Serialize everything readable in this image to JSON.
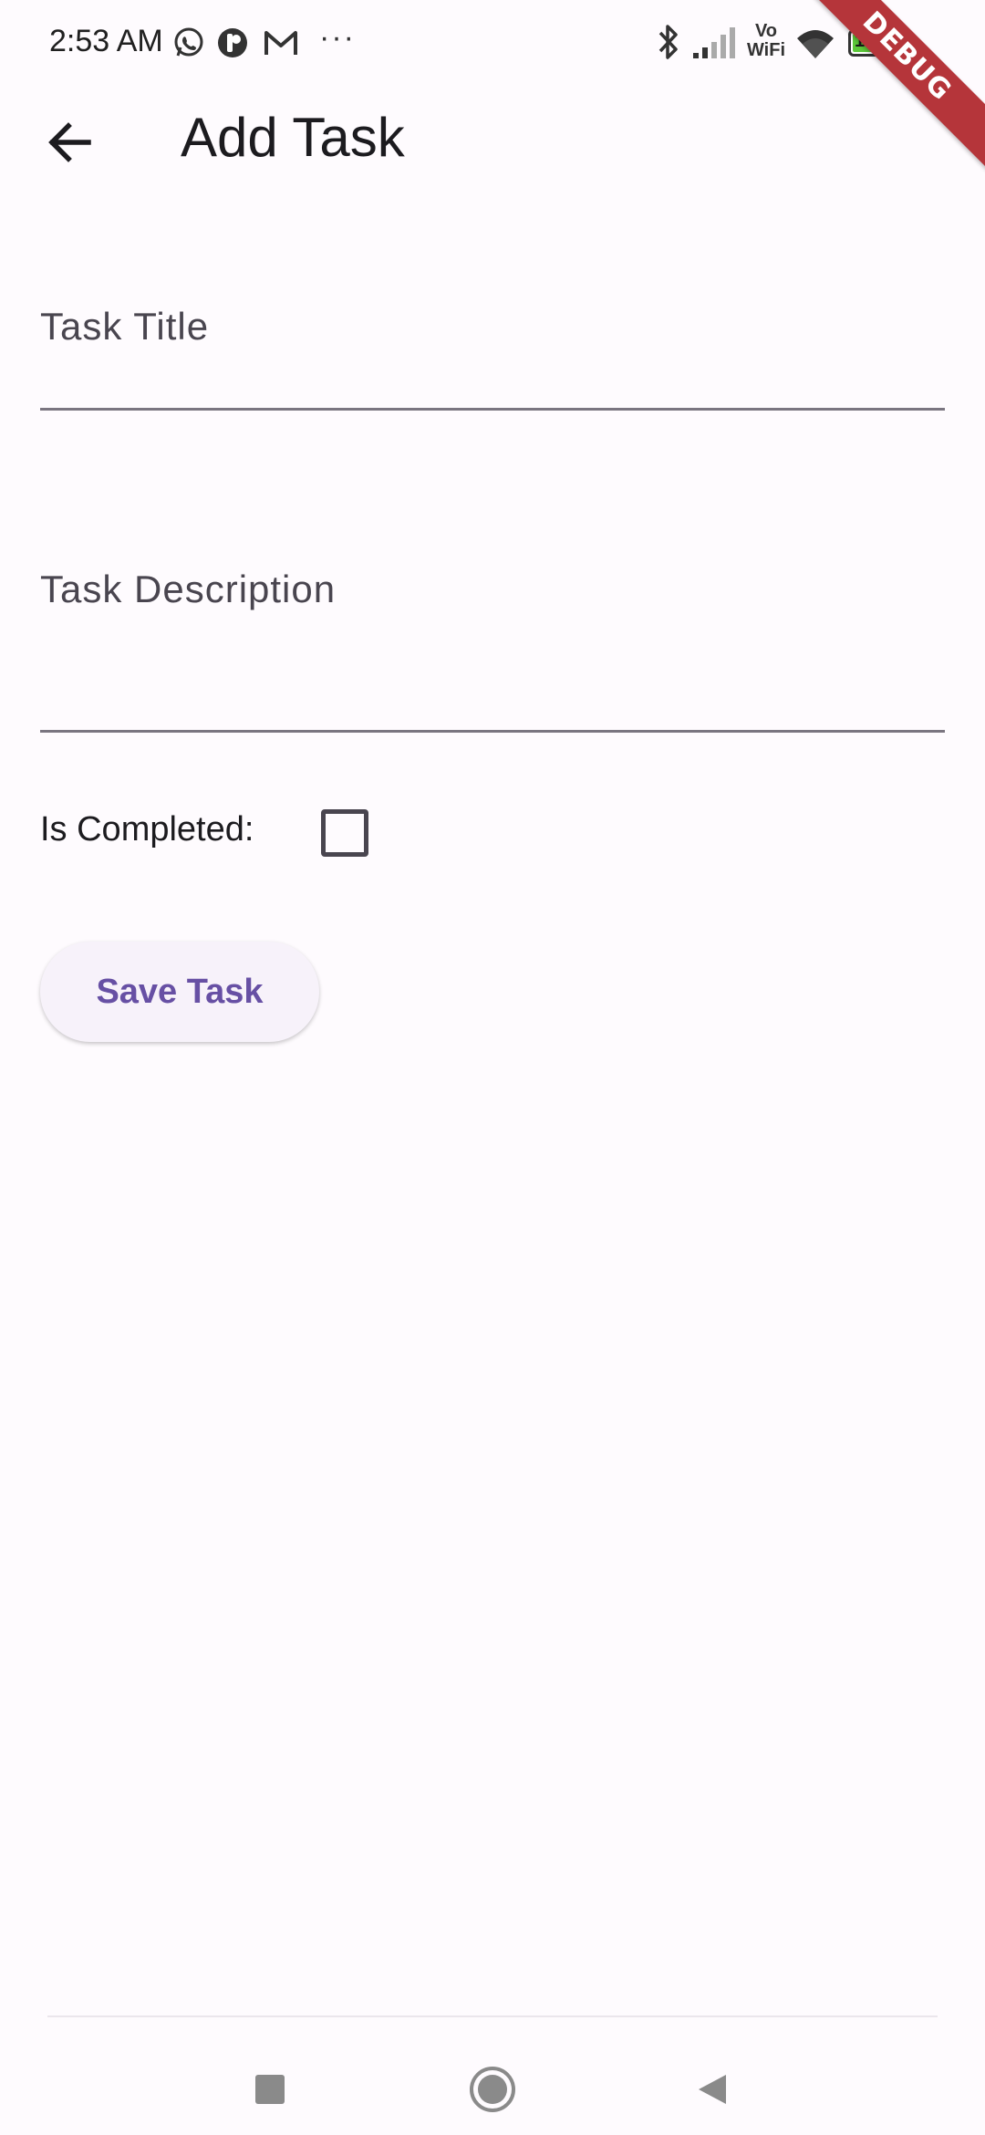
{
  "status_bar": {
    "time": "2:53 AM",
    "more_indicator": "···",
    "network_label_top": "Vo",
    "network_label_bottom": "WiFi",
    "battery": "100",
    "icons": [
      "whatsapp-icon",
      "app-icon",
      "gmail-icon",
      "bluetooth-icon",
      "signal-icon",
      "wifi-icon",
      "battery-icon",
      "charging-icon"
    ]
  },
  "debug_banner": "DEBUG",
  "app_bar": {
    "back_icon": "arrow-back-icon",
    "title": "Add Task"
  },
  "form": {
    "title_field": {
      "label": "Task Title",
      "value": ""
    },
    "description_field": {
      "label": "Task Description",
      "value": ""
    },
    "completed_label": "Is Completed:",
    "completed_checked": false,
    "save_label": "Save Task"
  },
  "nav_bar": {
    "buttons": [
      "recents-icon",
      "home-icon",
      "back-icon"
    ]
  },
  "colors": {
    "background": "#fefbfe",
    "accent": "#6750a4",
    "button_bg": "#f7f2fa",
    "debug": "#b5353a"
  }
}
